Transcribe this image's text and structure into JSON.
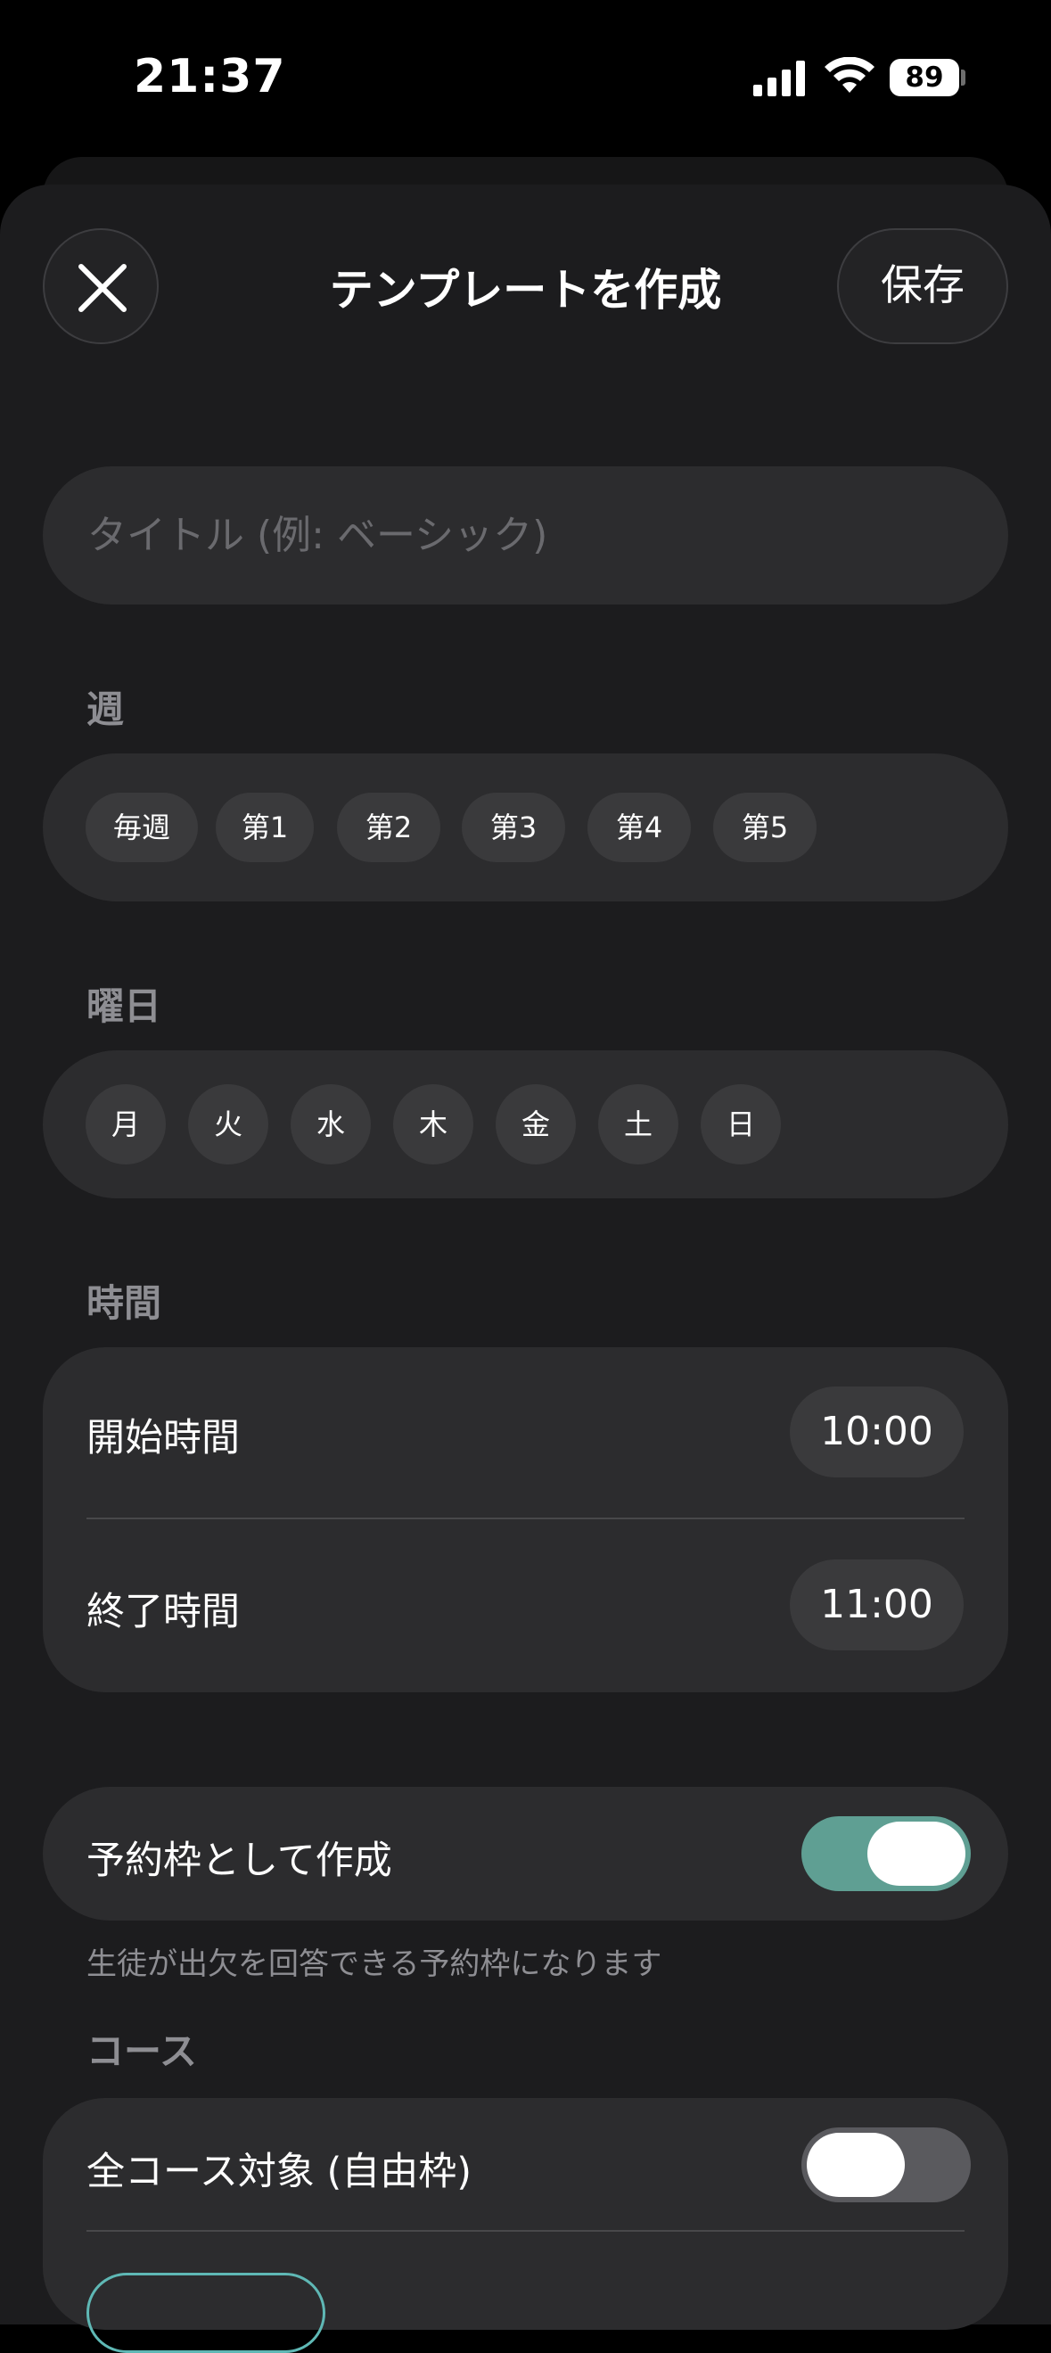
{
  "status_bar": {
    "time": "21:37",
    "battery": "89",
    "icons": [
      "cellular-signal-icon",
      "wifi-icon",
      "battery-icon"
    ]
  },
  "header": {
    "title": "テンプレートを作成",
    "save_label": "保存",
    "close_icon": "close-icon"
  },
  "title_field": {
    "placeholder": "タイトル (例: ベーシック)",
    "value": ""
  },
  "week_section": {
    "label": "週",
    "options": [
      "毎週",
      "第1",
      "第2",
      "第3",
      "第4",
      "第5"
    ]
  },
  "weekday_section": {
    "label": "曜日",
    "options": [
      "月",
      "火",
      "水",
      "木",
      "金",
      "土",
      "日"
    ]
  },
  "time_section": {
    "label": "時間",
    "start_label": "開始時間",
    "start_value": "10:00",
    "end_label": "終了時間",
    "end_value": "11:00"
  },
  "reservation": {
    "label": "予約枠として作成",
    "enabled": true,
    "helper": "生徒が出欠を回答できる予約枠になります"
  },
  "course_section": {
    "label": "コース",
    "all_courses_label": "全コース対象 (自由枠)",
    "all_courses_enabled": false
  },
  "colors": {
    "background": "#1c1c1e",
    "card": "#2c2c2e",
    "chip": "#3a3a3c",
    "toggle_on": "#5f9f93",
    "accent_teal": "#5fb8b5",
    "secondary_text": "#8e8e93"
  }
}
